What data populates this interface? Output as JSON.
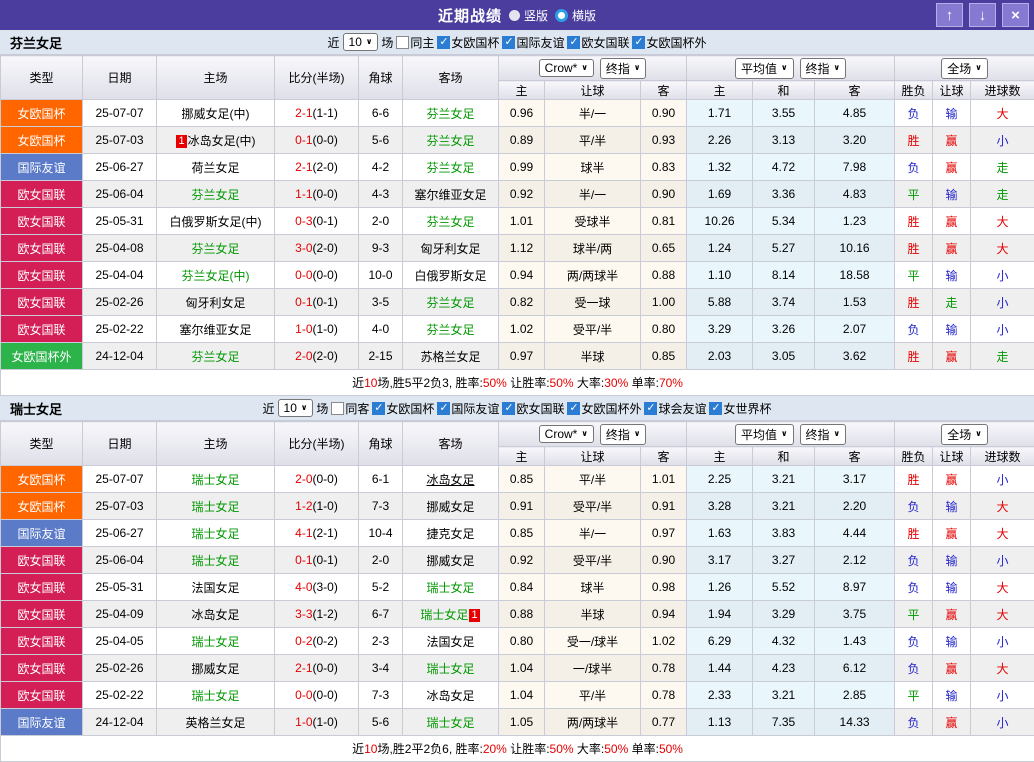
{
  "titlebar": {
    "title": "近期战绩",
    "radios": [
      {
        "label": "竖版",
        "selected": false
      },
      {
        "label": "横版",
        "selected": true
      }
    ],
    "buttons": [
      {
        "id": "up",
        "glyph": "↑"
      },
      {
        "id": "down",
        "glyph": "↓"
      },
      {
        "id": "close",
        "glyph": "×"
      }
    ]
  },
  "header": {
    "cols": [
      "类型",
      "日期",
      "主场",
      "比分(半场)",
      "角球",
      "客场"
    ],
    "dropdowns": {
      "odds_company": "Crow*",
      "odds_stage": "终指",
      "avg": "平均值",
      "avg_stage": "终指",
      "scope": "全场"
    },
    "sub_odds": [
      "主",
      "让球",
      "客"
    ],
    "sub_avg": [
      "主",
      "和",
      "客"
    ],
    "sub_result": [
      "胜负",
      "让球",
      "进球数"
    ]
  },
  "filter_common": {
    "near": "近",
    "games": "场"
  },
  "type_colors": {
    "女欧国杯": "#FF6600",
    "国际友谊": "#5B7BC9",
    "欧女国联": "#D41E56",
    "女欧国杯外": "#2CB34A"
  },
  "result_colors": {
    "胜": "#E60000",
    "赢": "#E60000",
    "大": "#E60000",
    "平": "#009900",
    "走": "#009900",
    "负": "#2222CC",
    "输": "#2222CC",
    "小": "#2222CC"
  },
  "sections": [
    {
      "team": "芬兰女足",
      "filter": {
        "count": "10",
        "same_side": "同主",
        "same_checked": false,
        "competitions": [
          "女欧国杯",
          "国际友谊",
          "欧女国联",
          "女欧国杯外"
        ]
      },
      "rows": [
        {
          "type": "女欧国杯",
          "date": "25-07-07",
          "home": "挪威女足(中)",
          "home_green": false,
          "score": "2-1",
          "half": "(1-1)",
          "corner": "6-6",
          "away": "芬兰女足",
          "away_green": true,
          "o_home": "0.96",
          "handicap": "半/一",
          "o_away": "0.90",
          "avg_home": "1.71",
          "avg_draw": "3.55",
          "avg_away": "4.85",
          "res_wdl": "负",
          "res_handicap": "输",
          "res_goals": "大"
        },
        {
          "type": "女欧国杯",
          "date": "25-07-03",
          "home": "冰岛女足(中)",
          "home_green": false,
          "home_card": "1",
          "score": "0-1",
          "half": "(0-0)",
          "corner": "5-6",
          "away": "芬兰女足",
          "away_green": true,
          "o_home": "0.89",
          "handicap": "平/半",
          "o_away": "0.93",
          "avg_home": "2.26",
          "avg_draw": "3.13",
          "avg_away": "3.20",
          "res_wdl": "胜",
          "res_handicap": "赢",
          "res_goals": "小"
        },
        {
          "type": "国际友谊",
          "date": "25-06-27",
          "home": "荷兰女足",
          "home_green": false,
          "score": "2-1",
          "half": "(2-0)",
          "corner": "4-2",
          "away": "芬兰女足",
          "away_green": true,
          "o_home": "0.99",
          "handicap": "球半",
          "o_away": "0.83",
          "avg_home": "1.32",
          "avg_draw": "4.72",
          "avg_away": "7.98",
          "res_wdl": "负",
          "res_handicap": "赢",
          "res_goals": "走"
        },
        {
          "type": "欧女国联",
          "date": "25-06-04",
          "home": "芬兰女足",
          "home_green": true,
          "score": "1-1",
          "half": "(0-0)",
          "corner": "4-3",
          "away": "塞尔维亚女足",
          "away_green": false,
          "o_home": "0.92",
          "handicap": "半/一",
          "o_away": "0.90",
          "avg_home": "1.69",
          "avg_draw": "3.36",
          "avg_away": "4.83",
          "res_wdl": "平",
          "res_handicap": "输",
          "res_goals": "走"
        },
        {
          "type": "欧女国联",
          "date": "25-05-31",
          "home": "白俄罗斯女足(中)",
          "home_green": false,
          "score": "0-3",
          "half": "(0-1)",
          "corner": "2-0",
          "away": "芬兰女足",
          "away_green": true,
          "o_home": "1.01",
          "handicap": "受球半",
          "o_away": "0.81",
          "avg_home": "10.26",
          "avg_draw": "5.34",
          "avg_away": "1.23",
          "res_wdl": "胜",
          "res_handicap": "赢",
          "res_goals": "大"
        },
        {
          "type": "欧女国联",
          "date": "25-04-08",
          "home": "芬兰女足",
          "home_green": true,
          "score": "3-0",
          "half": "(2-0)",
          "corner": "9-3",
          "away": "匈牙利女足",
          "away_green": false,
          "o_home": "1.12",
          "handicap": "球半/两",
          "o_away": "0.65",
          "avg_home": "1.24",
          "avg_draw": "5.27",
          "avg_away": "10.16",
          "res_wdl": "胜",
          "res_handicap": "赢",
          "res_goals": "大"
        },
        {
          "type": "欧女国联",
          "date": "25-04-04",
          "home": "芬兰女足(中)",
          "home_green": true,
          "score": "0-0",
          "half": "(0-0)",
          "corner": "10-0",
          "away": "白俄罗斯女足",
          "away_green": false,
          "o_home": "0.94",
          "handicap": "两/两球半",
          "o_away": "0.88",
          "avg_home": "1.10",
          "avg_draw": "8.14",
          "avg_away": "18.58",
          "res_wdl": "平",
          "res_handicap": "输",
          "res_goals": "小"
        },
        {
          "type": "欧女国联",
          "date": "25-02-26",
          "home": "匈牙利女足",
          "home_green": false,
          "score": "0-1",
          "half": "(0-1)",
          "corner": "3-5",
          "away": "芬兰女足",
          "away_green": true,
          "o_home": "0.82",
          "handicap": "受一球",
          "o_away": "1.00",
          "avg_home": "5.88",
          "avg_draw": "3.74",
          "avg_away": "1.53",
          "res_wdl": "胜",
          "res_handicap": "走",
          "res_goals": "小"
        },
        {
          "type": "欧女国联",
          "date": "25-02-22",
          "home": "塞尔维亚女足",
          "home_green": false,
          "score": "1-0",
          "half": "(1-0)",
          "corner": "4-0",
          "away": "芬兰女足",
          "away_green": true,
          "o_home": "1.02",
          "handicap": "受平/半",
          "o_away": "0.80",
          "avg_home": "3.29",
          "avg_draw": "3.26",
          "avg_away": "2.07",
          "res_wdl": "负",
          "res_handicap": "输",
          "res_goals": "小"
        },
        {
          "type": "女欧国杯外",
          "date": "24-12-04",
          "home": "芬兰女足",
          "home_green": true,
          "score": "2-0",
          "half": "(2-0)",
          "corner": "2-15",
          "away": "苏格兰女足",
          "away_green": false,
          "o_home": "0.97",
          "handicap": "半球",
          "o_away": "0.85",
          "avg_home": "2.03",
          "avg_draw": "3.05",
          "avg_away": "3.62",
          "res_wdl": "胜",
          "res_handicap": "赢",
          "res_goals": "走"
        }
      ],
      "summary": [
        {
          "t": "近",
          "red": false
        },
        {
          "t": "10",
          "red": true
        },
        {
          "t": "场,胜5平2负3, 胜率:",
          "red": false
        },
        {
          "t": "50%",
          "red": true
        },
        {
          "t": " 让胜率:",
          "red": false
        },
        {
          "t": "50%",
          "red": true
        },
        {
          "t": " 大率:",
          "red": false
        },
        {
          "t": "30%",
          "red": true
        },
        {
          "t": " 单率:",
          "red": false
        },
        {
          "t": "70%",
          "red": true
        }
      ]
    },
    {
      "team": "瑞士女足",
      "filter": {
        "count": "10",
        "same_side": "同客",
        "same_checked": false,
        "competitions": [
          "女欧国杯",
          "国际友谊",
          "欧女国联",
          "女欧国杯外",
          "球会友谊",
          "女世界杯"
        ]
      },
      "rows": [
        {
          "type": "女欧国杯",
          "date": "25-07-07",
          "home": "瑞士女足",
          "home_green": true,
          "score": "2-0",
          "half": "(0-0)",
          "corner": "6-1",
          "away": "冰岛女足",
          "away_green": false,
          "away_underline": true,
          "o_home": "0.85",
          "handicap": "平/半",
          "o_away": "1.01",
          "avg_home": "2.25",
          "avg_draw": "3.21",
          "avg_away": "3.17",
          "res_wdl": "胜",
          "res_handicap": "赢",
          "res_goals": "小"
        },
        {
          "type": "女欧国杯",
          "date": "25-07-03",
          "home": "瑞士女足",
          "home_green": true,
          "score": "1-2",
          "half": "(1-0)",
          "corner": "7-3",
          "away": "挪威女足",
          "away_green": false,
          "o_home": "0.91",
          "handicap": "受平/半",
          "o_away": "0.91",
          "avg_home": "3.28",
          "avg_draw": "3.21",
          "avg_away": "2.20",
          "res_wdl": "负",
          "res_handicap": "输",
          "res_goals": "大"
        },
        {
          "type": "国际友谊",
          "date": "25-06-27",
          "home": "瑞士女足",
          "home_green": true,
          "score": "4-1",
          "half": "(2-1)",
          "corner": "10-4",
          "away": "捷克女足",
          "away_green": false,
          "o_home": "0.85",
          "handicap": "半/一",
          "o_away": "0.97",
          "avg_home": "1.63",
          "avg_draw": "3.83",
          "avg_away": "4.44",
          "res_wdl": "胜",
          "res_handicap": "赢",
          "res_goals": "大"
        },
        {
          "type": "欧女国联",
          "date": "25-06-04",
          "home": "瑞士女足",
          "home_green": true,
          "score": "0-1",
          "half": "(0-1)",
          "corner": "2-0",
          "away": "挪威女足",
          "away_green": false,
          "o_home": "0.92",
          "handicap": "受平/半",
          "o_away": "0.90",
          "avg_home": "3.17",
          "avg_draw": "3.27",
          "avg_away": "2.12",
          "res_wdl": "负",
          "res_handicap": "输",
          "res_goals": "小"
        },
        {
          "type": "欧女国联",
          "date": "25-05-31",
          "home": "法国女足",
          "home_green": false,
          "score": "4-0",
          "half": "(3-0)",
          "corner": "5-2",
          "away": "瑞士女足",
          "away_green": true,
          "o_home": "0.84",
          "handicap": "球半",
          "o_away": "0.98",
          "avg_home": "1.26",
          "avg_draw": "5.52",
          "avg_away": "8.97",
          "res_wdl": "负",
          "res_handicap": "输",
          "res_goals": "大"
        },
        {
          "type": "欧女国联",
          "date": "25-04-09",
          "home": "冰岛女足",
          "home_green": false,
          "score": "3-3",
          "half": "(1-2)",
          "corner": "6-7",
          "away": "瑞士女足",
          "away_green": true,
          "away_card": "1",
          "o_home": "0.88",
          "handicap": "半球",
          "o_away": "0.94",
          "avg_home": "1.94",
          "avg_draw": "3.29",
          "avg_away": "3.75",
          "res_wdl": "平",
          "res_handicap": "赢",
          "res_goals": "大"
        },
        {
          "type": "欧女国联",
          "date": "25-04-05",
          "home": "瑞士女足",
          "home_green": true,
          "score": "0-2",
          "half": "(0-2)",
          "corner": "2-3",
          "away": "法国女足",
          "away_green": false,
          "o_home": "0.80",
          "handicap": "受一/球半",
          "o_away": "1.02",
          "avg_home": "6.29",
          "avg_draw": "4.32",
          "avg_away": "1.43",
          "res_wdl": "负",
          "res_handicap": "输",
          "res_goals": "小"
        },
        {
          "type": "欧女国联",
          "date": "25-02-26",
          "home": "挪威女足",
          "home_green": false,
          "score": "2-1",
          "half": "(0-0)",
          "corner": "3-4",
          "away": "瑞士女足",
          "away_green": true,
          "o_home": "1.04",
          "handicap": "一/球半",
          "o_away": "0.78",
          "avg_home": "1.44",
          "avg_draw": "4.23",
          "avg_away": "6.12",
          "res_wdl": "负",
          "res_handicap": "赢",
          "res_goals": "大"
        },
        {
          "type": "欧女国联",
          "date": "25-02-22",
          "home": "瑞士女足",
          "home_green": true,
          "score": "0-0",
          "half": "(0-0)",
          "corner": "7-3",
          "away": "冰岛女足",
          "away_green": false,
          "o_home": "1.04",
          "handicap": "平/半",
          "o_away": "0.78",
          "avg_home": "2.33",
          "avg_draw": "3.21",
          "avg_away": "2.85",
          "res_wdl": "平",
          "res_handicap": "输",
          "res_goals": "小"
        },
        {
          "type": "国际友谊",
          "date": "24-12-04",
          "home": "英格兰女足",
          "home_green": false,
          "score": "1-0",
          "half": "(1-0)",
          "corner": "5-6",
          "away": "瑞士女足",
          "away_green": true,
          "o_home": "1.05",
          "handicap": "两/两球半",
          "o_away": "0.77",
          "avg_home": "1.13",
          "avg_draw": "7.35",
          "avg_away": "14.33",
          "res_wdl": "负",
          "res_handicap": "赢",
          "res_goals": "小"
        }
      ],
      "summary": [
        {
          "t": "近",
          "red": false
        },
        {
          "t": "10",
          "red": true
        },
        {
          "t": "场,胜2平2负6, 胜率:",
          "red": false
        },
        {
          "t": "20%",
          "red": true
        },
        {
          "t": " 让胜率:",
          "red": false
        },
        {
          "t": "50%",
          "red": true
        },
        {
          "t": " 大率:",
          "red": false
        },
        {
          "t": "50%",
          "red": true
        },
        {
          "t": " 单率:",
          "red": false
        },
        {
          "t": "50%",
          "red": true
        }
      ]
    }
  ]
}
